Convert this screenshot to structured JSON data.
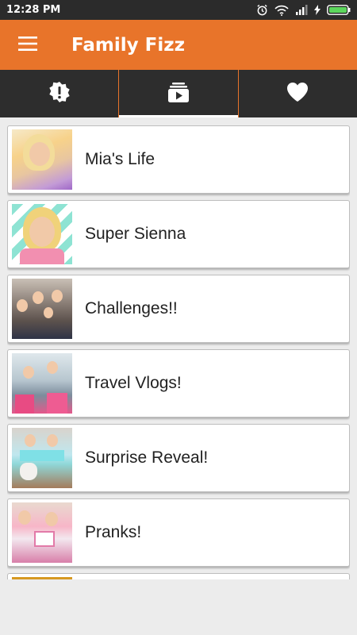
{
  "status_bar": {
    "time": "12:28 PM",
    "icons": [
      "alarm-icon",
      "wifi-icon",
      "signal-icon",
      "charging-icon",
      "battery-icon"
    ]
  },
  "app_bar": {
    "title": "Family Fizz",
    "menu_icon": "hamburger-menu-icon"
  },
  "tabs": [
    {
      "icon": "alert-badge-icon",
      "active": false
    },
    {
      "icon": "video-playlist-icon",
      "active": true
    },
    {
      "icon": "heart-icon",
      "active": false
    }
  ],
  "playlists": [
    {
      "label": "Mia's Life",
      "thumb": "t1"
    },
    {
      "label": "Super Sienna",
      "thumb": "t2"
    },
    {
      "label": "Challenges!!",
      "thumb": "t3"
    },
    {
      "label": "Travel Vlogs!",
      "thumb": "t4"
    },
    {
      "label": "Surprise Reveal!",
      "thumb": "t5"
    },
    {
      "label": "Pranks!",
      "thumb": "t6"
    },
    {
      "label": "",
      "thumb": "t7"
    }
  ],
  "colors": {
    "accent": "#e8742a",
    "tab_bar": "#2d2d2d",
    "status_bar": "#2b2b2b",
    "background": "#ececec",
    "battery": "#5cd65c"
  }
}
